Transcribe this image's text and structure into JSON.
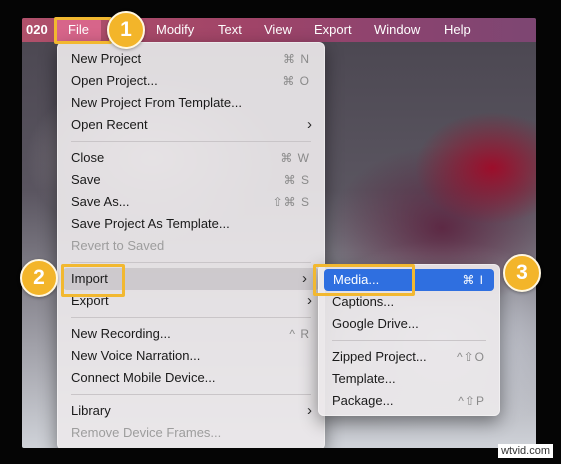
{
  "menubar": {
    "app_fragment": "020",
    "items": [
      "File",
      "Modify",
      "Text",
      "View",
      "Export",
      "Window",
      "Help"
    ]
  },
  "file_menu": {
    "items": {
      "new_project": {
        "label": "New Project",
        "shortcut": "⌘ N"
      },
      "open_project": {
        "label": "Open Project...",
        "shortcut": "⌘ O"
      },
      "new_from_template": {
        "label": "New Project From Template..."
      },
      "open_recent": {
        "label": "Open Recent"
      },
      "close": {
        "label": "Close",
        "shortcut": "⌘ W"
      },
      "save": {
        "label": "Save",
        "shortcut": "⌘ S"
      },
      "save_as": {
        "label": "Save As...",
        "shortcut": "⇧⌘ S"
      },
      "save_as_template": {
        "label": "Save Project As Template..."
      },
      "revert": {
        "label": "Revert to Saved"
      },
      "import": {
        "label": "Import"
      },
      "export": {
        "label": "Export"
      },
      "new_recording": {
        "label": "New Recording...",
        "shortcut": "^ R"
      },
      "new_voice": {
        "label": "New Voice Narration..."
      },
      "connect_mobile": {
        "label": "Connect Mobile Device..."
      },
      "library": {
        "label": "Library"
      },
      "remove_frames": {
        "label": "Remove Device Frames..."
      }
    }
  },
  "import_menu": {
    "items": {
      "media": {
        "label": "Media...",
        "shortcut": "⌘ I"
      },
      "captions": {
        "label": "Captions..."
      },
      "google_drive": {
        "label": "Google Drive..."
      },
      "zipped_project": {
        "label": "Zipped Project...",
        "shortcut": "^⇧O"
      },
      "template": {
        "label": "Template..."
      },
      "package": {
        "label": "Package...",
        "shortcut": "^⇧P"
      }
    }
  },
  "badges": [
    "1",
    "2",
    "3"
  ],
  "watermark": "wtvid.com",
  "colors": {
    "highlight": "#f2b830",
    "selected": "#2f6fe0",
    "menubar": "#a04468"
  }
}
